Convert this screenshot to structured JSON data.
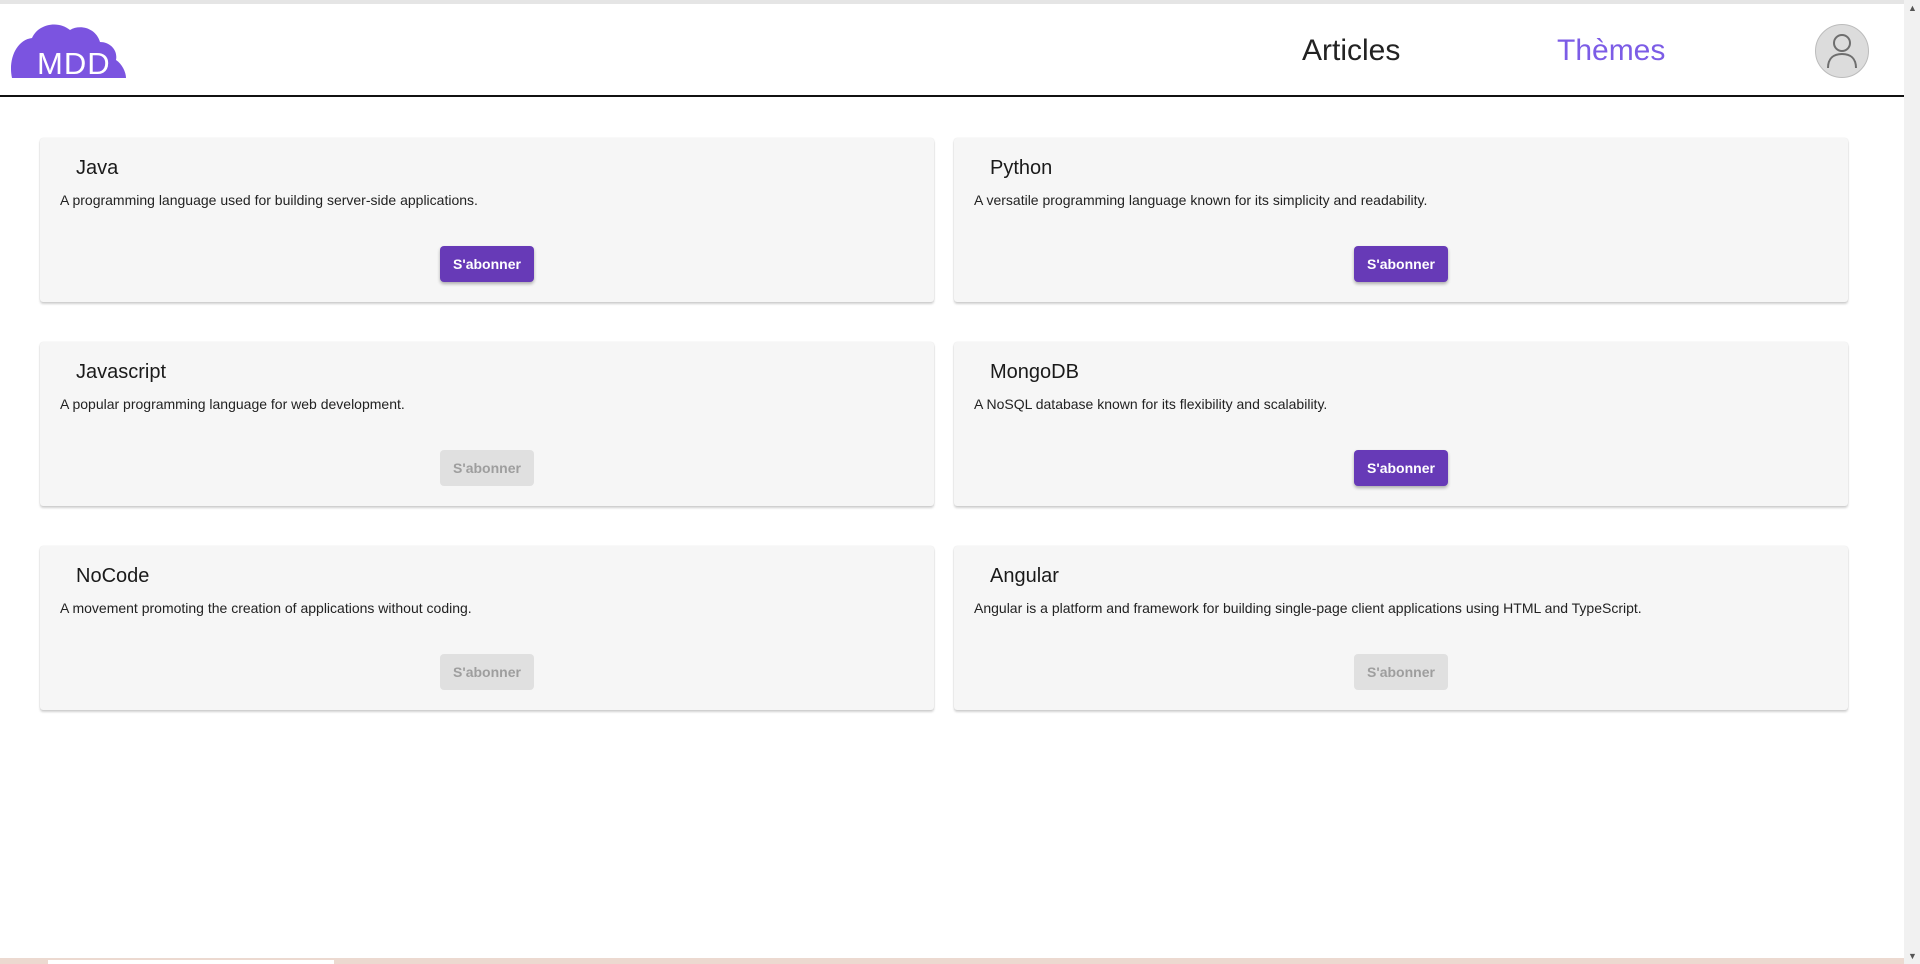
{
  "header": {
    "logo_text": "MDD",
    "nav": {
      "articles": "Articles",
      "themes": "Thèmes"
    },
    "avatar_icon": "user-icon"
  },
  "colors": {
    "accent": "#673ab7",
    "nav_active": "#7c5ce6",
    "logo": "#7b54e0",
    "card_bg": "#f6f6f6",
    "disabled_bg": "#e0e0e0"
  },
  "themes": [
    {
      "title": "Java",
      "description": "A programming language used for building server-side applications.",
      "button_label": "S'abonner",
      "subscribed": false
    },
    {
      "title": "Python",
      "description": "A versatile programming language known for its simplicity and readability.",
      "button_label": "S'abonner",
      "subscribed": false
    },
    {
      "title": "Javascript",
      "description": "A popular programming language for web development.",
      "button_label": "S'abonner",
      "subscribed": true
    },
    {
      "title": "MongoDB",
      "description": "A NoSQL database known for its flexibility and scalability.",
      "button_label": "S'abonner",
      "subscribed": false
    },
    {
      "title": "NoCode",
      "description": "A movement promoting the creation of applications without coding.",
      "button_label": "S'abonner",
      "subscribed": true
    },
    {
      "title": "Angular",
      "description": "Angular is a platform and framework for building single-page client applications using HTML and TypeScript.",
      "button_label": "S'abonner",
      "subscribed": true
    }
  ]
}
